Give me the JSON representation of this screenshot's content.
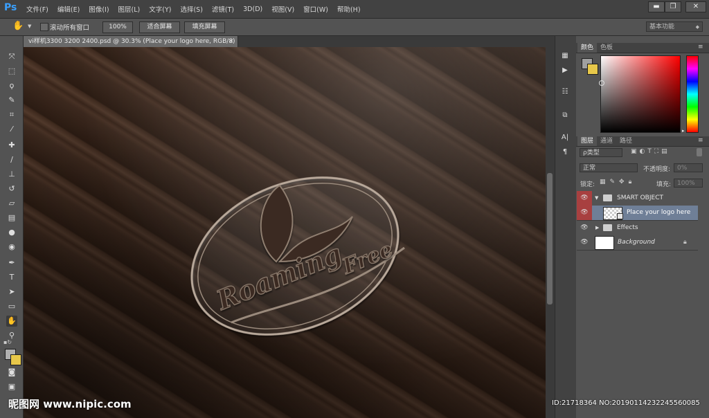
{
  "app": {
    "logo": "Ps"
  },
  "menu": [
    "文件(F)",
    "编辑(E)",
    "图像(I)",
    "图层(L)",
    "文字(Y)",
    "选择(S)",
    "滤镜(T)",
    "3D(D)",
    "视图(V)",
    "窗口(W)",
    "帮助(H)"
  ],
  "window_buttons": {
    "minimize": "▬",
    "restore": "❐",
    "close": "✕"
  },
  "options_bar": {
    "scroll_all_label": "滚动所有窗口",
    "zoom_100": "100%",
    "fit_screen": "适合屏幕",
    "fill_screen": "填充屏幕",
    "workspace": "基本功能"
  },
  "document": {
    "tab_title": "vi样机3300 3200 2400.psd @ 30.3% (Place your logo here, RGB/8)",
    "close_glyph": "×"
  },
  "logo_art": {
    "line1": "Roaming",
    "line2": "Free"
  },
  "color_panel": {
    "tabs": [
      "颜色",
      "色板"
    ],
    "fg_color": "#a0a0a0",
    "bg_color": "#e8c84a"
  },
  "layers_panel": {
    "tabs": [
      "图层",
      "通道",
      "路径"
    ],
    "kind_filter": "ρ类型",
    "blend_mode": "正常",
    "opacity_label": "不透明度:",
    "opacity_value": "0%",
    "lock_label": "锁定:",
    "fill_label": "填充:",
    "fill_value": "100%",
    "layers": [
      {
        "name": "SMART OBJECT",
        "type": "group",
        "expanded": true
      },
      {
        "name": "Place your logo here",
        "type": "smart-object",
        "selected": true
      },
      {
        "name": "Effects",
        "type": "group",
        "expanded": false
      },
      {
        "name": "Background",
        "type": "background",
        "locked": true
      }
    ]
  },
  "watermark": {
    "left": "昵图网 www.nipic.com",
    "right": "ID:21718364 NO:20190114232245560085"
  }
}
